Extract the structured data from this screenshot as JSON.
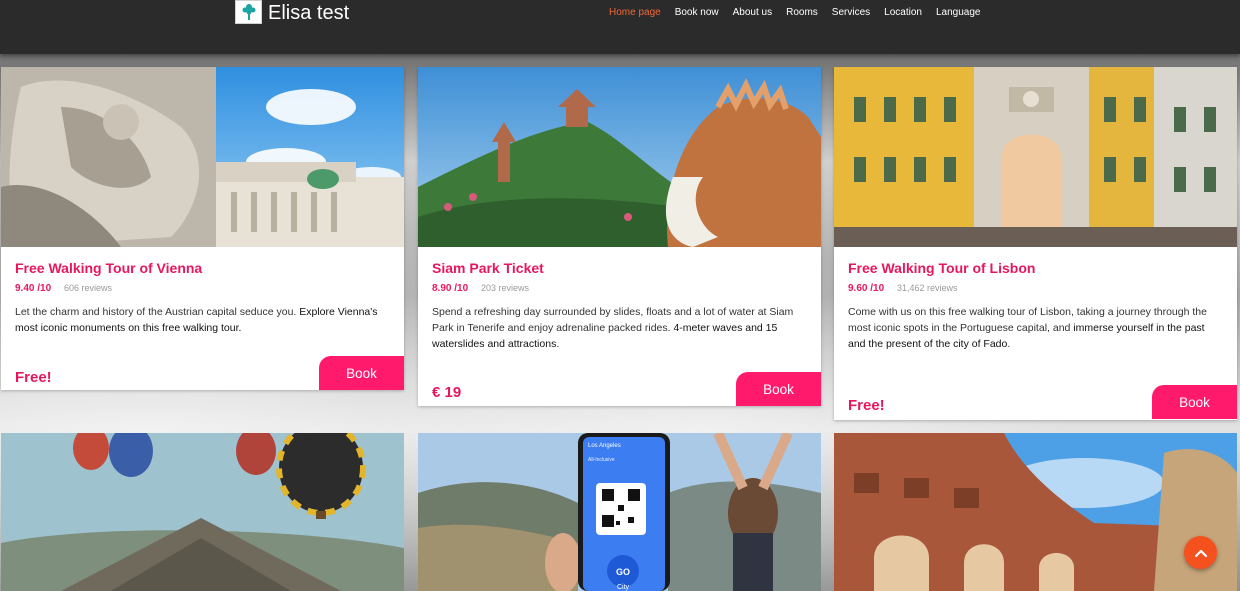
{
  "site": {
    "name": "Elisa test",
    "logo_icon": "brand-flower-logo-icon",
    "accent_color": "#ff1a6c",
    "title_color": "#e8175d",
    "nav_active_color": "#f26836"
  },
  "nav": {
    "items": [
      {
        "label": "Home page",
        "active": true
      },
      {
        "label": "Book now",
        "active": false
      },
      {
        "label": "About us",
        "active": false
      },
      {
        "label": "Rooms",
        "active": false
      },
      {
        "label": "Services",
        "active": false
      },
      {
        "label": "Location",
        "active": false
      },
      {
        "label": "Language",
        "active": false
      }
    ]
  },
  "cards": [
    {
      "title": "Free Walking Tour of Vienna",
      "rating": "9.40 /10",
      "reviews": "606 reviews",
      "desc_plain": "Let the charm and history of the Austrian capital seduce you. ",
      "desc_highlight": "Explore Vienna's most iconic monuments on this free walking tour.",
      "desc_tail": "",
      "price": "Free!",
      "book_label": "Book",
      "image_icon": "vienna-statue-palace-image"
    },
    {
      "title": "Siam Park Ticket",
      "rating": "8.90 /10",
      "reviews": "203 reviews",
      "desc_plain": "Spend a refreshing day surrounded by slides, floats and a lot of water at Siam Park in Tenerife and enjoy adrenaline packed rides. ",
      "desc_highlight": "4-meter waves and 15 waterslides and attractions",
      "desc_tail": ".",
      "price": "€ 19",
      "book_label": "Book",
      "image_icon": "siam-park-dragon-image"
    },
    {
      "title": "Free Walking Tour of Lisbon",
      "rating": "9.60 /10",
      "reviews": "31,462 reviews",
      "desc_plain": "Come with us on this free walking tour of Lisbon, taking a journey through the most iconic spots in the Portuguese capital, and ",
      "desc_highlight": "immerse yourself in the past and the present of the city of Fado",
      "desc_tail": ".",
      "price": "Free!",
      "book_label": "Book",
      "image_icon": "lisbon-arch-street-image"
    }
  ],
  "bottom_cards": [
    {
      "image_icon": "teotihuacan-balloons-image"
    },
    {
      "image_icon": "los-angeles-go-city-pass-image",
      "pass_city": "Los Angeles",
      "pass_type": "All-Inclusive",
      "pass_brand": "GO",
      "pass_brand_sub": "City"
    },
    {
      "image_icon": "colosseum-rome-image"
    }
  ],
  "scroll_top_icon": "chevron-up-icon"
}
